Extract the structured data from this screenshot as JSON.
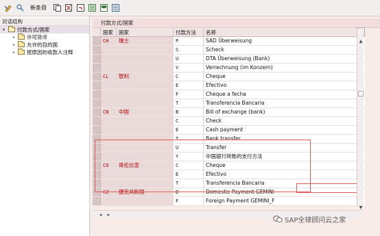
{
  "toolbar": {
    "new_entries_label": "新条目"
  },
  "left_panel": {
    "title": "对话结构",
    "tree": {
      "root_label": "付款方式/国家",
      "children": [
        {
          "label": "许可货币"
        },
        {
          "label": "允许的目的国"
        },
        {
          "label": "按原因的收款人注释"
        }
      ]
    }
  },
  "right_panel": {
    "title": "付款方式/国家",
    "columns": {
      "code": "国家",
      "country_name": "国家",
      "method": "付款方法",
      "name": "名称"
    },
    "rows": [
      {
        "code": "CH",
        "country_name": "瑞士",
        "method": "P",
        "name": "SAD Überweisung"
      },
      {
        "code": "",
        "country_name": "",
        "method": "S",
        "name": "Scheck"
      },
      {
        "code": "",
        "country_name": "",
        "method": "U",
        "name": "DTA Überweisung (Bank)"
      },
      {
        "code": "",
        "country_name": "",
        "method": "V",
        "name": "Verrechnung (im Konzern)"
      },
      {
        "code": "CL",
        "country_name": "智利",
        "method": "C",
        "name": "Cheque"
      },
      {
        "code": "",
        "country_name": "",
        "method": "E",
        "name": "Efectivo"
      },
      {
        "code": "",
        "country_name": "",
        "method": "F",
        "name": "Cheque a fecha"
      },
      {
        "code": "",
        "country_name": "",
        "method": "T",
        "name": "Transferencia Bancaria"
      },
      {
        "code": "CN",
        "country_name": "中国",
        "method": "B",
        "name": "Bill of exchange (bank)"
      },
      {
        "code": "",
        "country_name": "",
        "method": "C",
        "name": "Check"
      },
      {
        "code": "",
        "country_name": "",
        "method": "E",
        "name": "Cash payment"
      },
      {
        "code": "",
        "country_name": "",
        "method": "T",
        "name": "Bank transfer"
      },
      {
        "code": "",
        "country_name": "",
        "method": "U",
        "name": "Transfer"
      },
      {
        "code": "",
        "country_name": "",
        "method": "Y",
        "name": "中国银行转账的支付方法"
      },
      {
        "code": "CO",
        "country_name": "哥伦比亚",
        "method": "C",
        "name": "Cheque"
      },
      {
        "code": "",
        "country_name": "",
        "method": "E",
        "name": "Efectivo"
      },
      {
        "code": "",
        "country_name": "",
        "method": "T",
        "name": "Transferencia Bancaria"
      },
      {
        "code": "CZ",
        "country_name": "捷克共和国",
        "method": "D",
        "name": "Domestic Payment GEMINI"
      },
      {
        "code": "",
        "country_name": "",
        "method": "F",
        "name": "Foreign Payment GEMINI_F"
      }
    ]
  },
  "watermark": {
    "text": "SAP全球顾问云之家"
  },
  "colors": {
    "country_text": "#b00000",
    "highlight": "#e05a5a",
    "toolbar_bg": "#f3eeee"
  }
}
